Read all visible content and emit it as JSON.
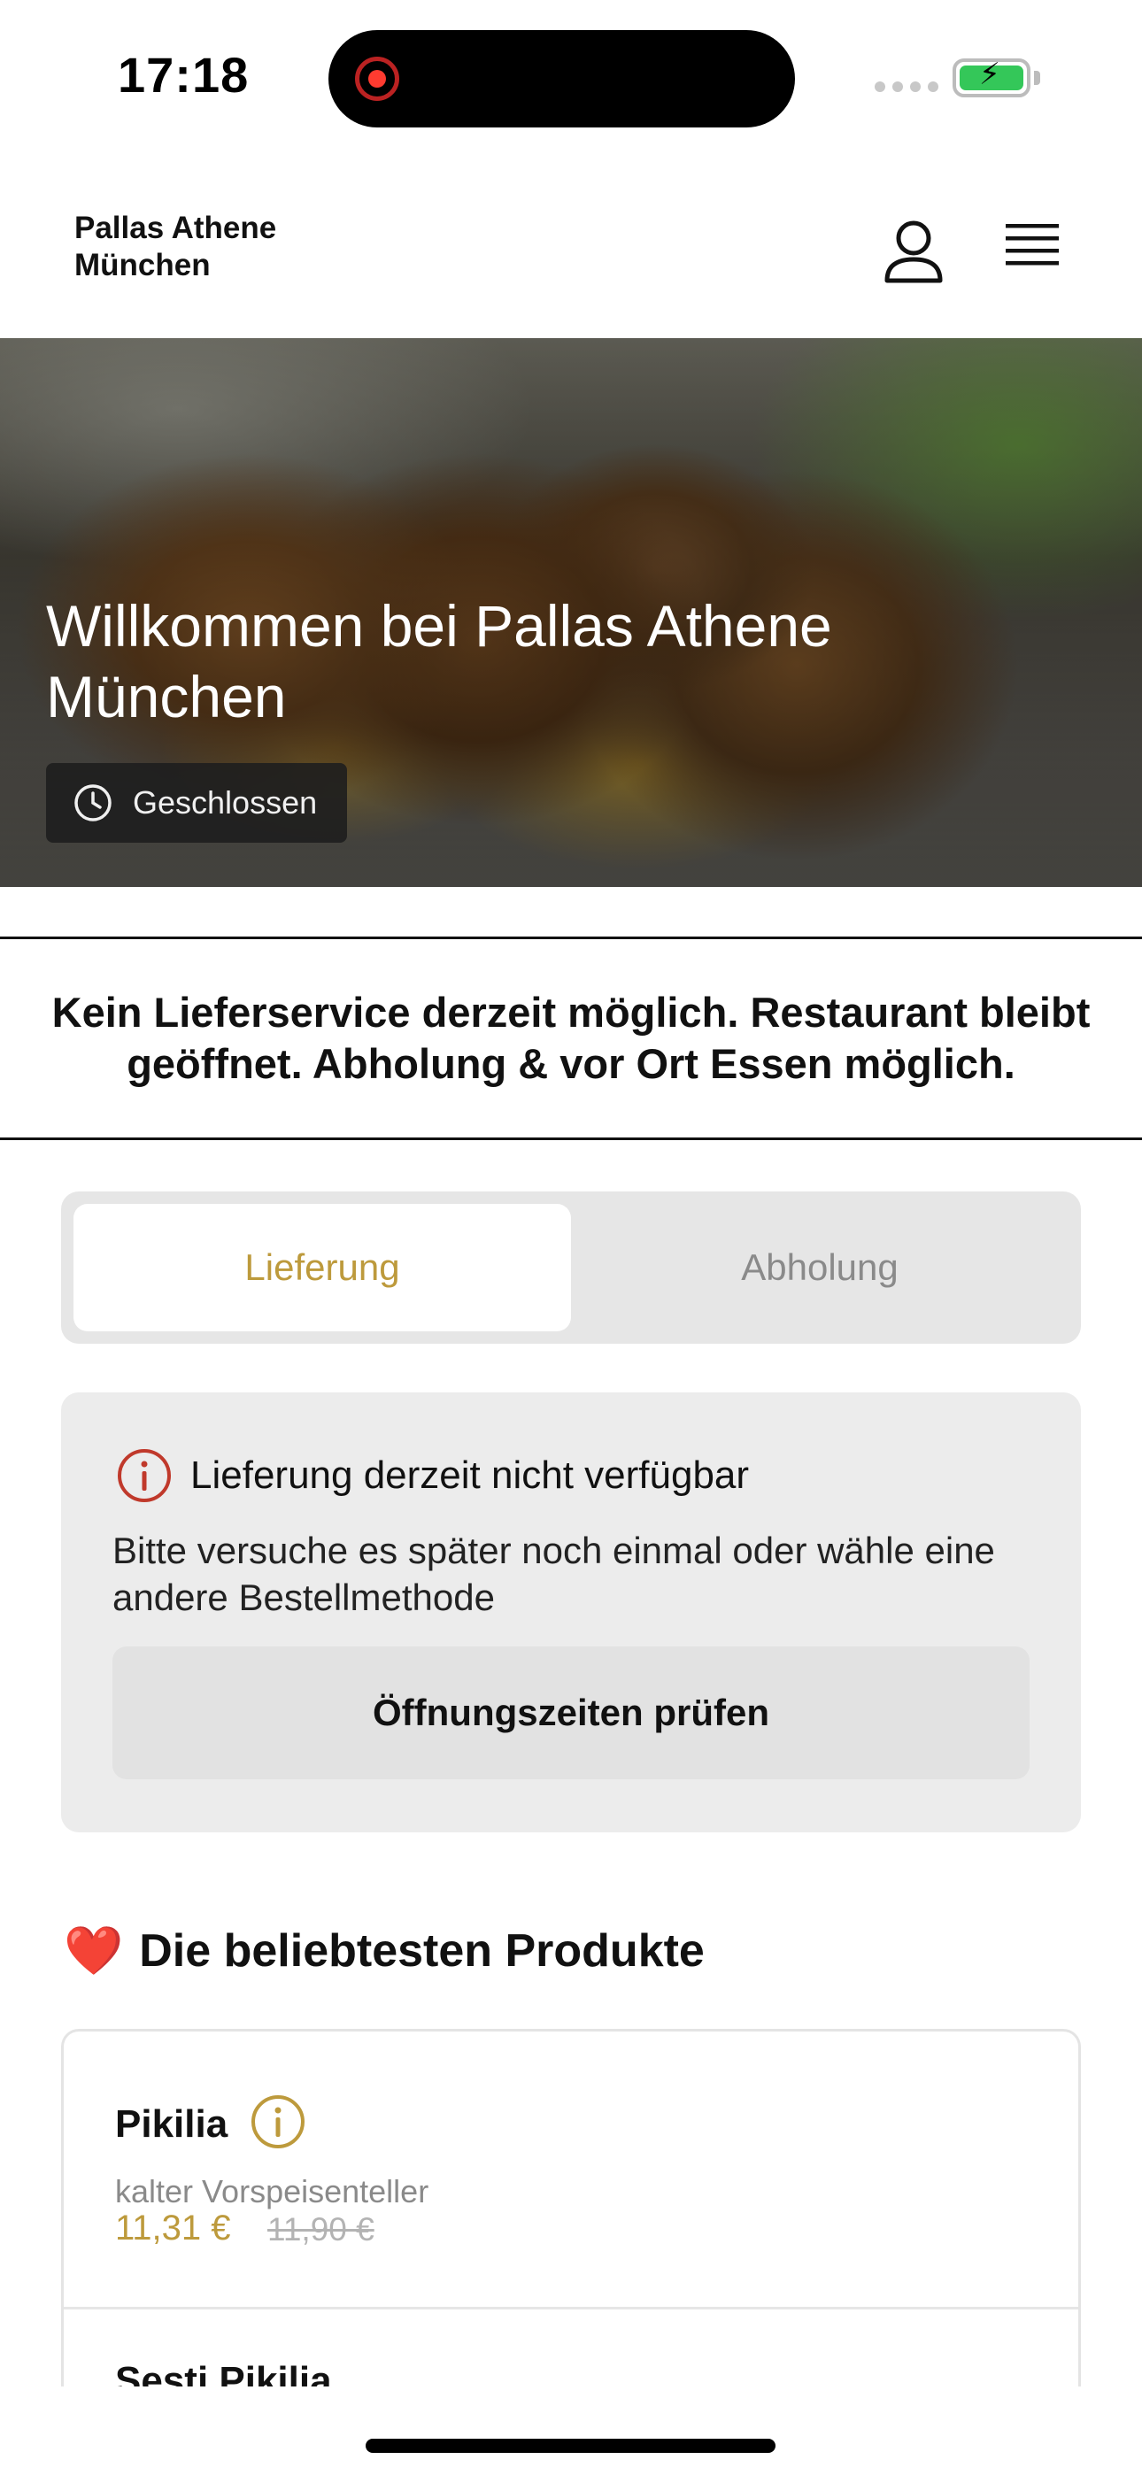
{
  "status_bar": {
    "time": "17:18"
  },
  "header": {
    "brand_line1": "Pallas Athene",
    "brand_line2": "München"
  },
  "hero": {
    "title": "Willkommen bei Pallas Athene München",
    "status": "Geschlossen"
  },
  "notice": {
    "text": "Kein Lieferservice derzeit möglich. Restaurant bleibt geöffnet. Abholung & vor Ort Essen möglich."
  },
  "order_mode": {
    "tabs": [
      "Lieferung",
      "Abholung"
    ],
    "selected": "Lieferung"
  },
  "alert": {
    "title": "Lieferung derzeit nicht verfügbar",
    "body": "Bitte versuche es später noch einmal oder wähle eine andere Bestellmethode",
    "button": "Öffnungszeiten prüfen"
  },
  "popular": {
    "title": "Die beliebtesten Produkte",
    "emoji": "❤️",
    "products": [
      {
        "name": "Pikilia",
        "description": "kalter Vorspeisenteller",
        "price": "11,31 €",
        "old_price": "11,90 €"
      },
      {
        "name": "Sesti Pikilia"
      }
    ]
  },
  "colors": {
    "accent": "#bd9a3c",
    "alert_icon": "#c0392b",
    "heart": "#d91f26"
  }
}
